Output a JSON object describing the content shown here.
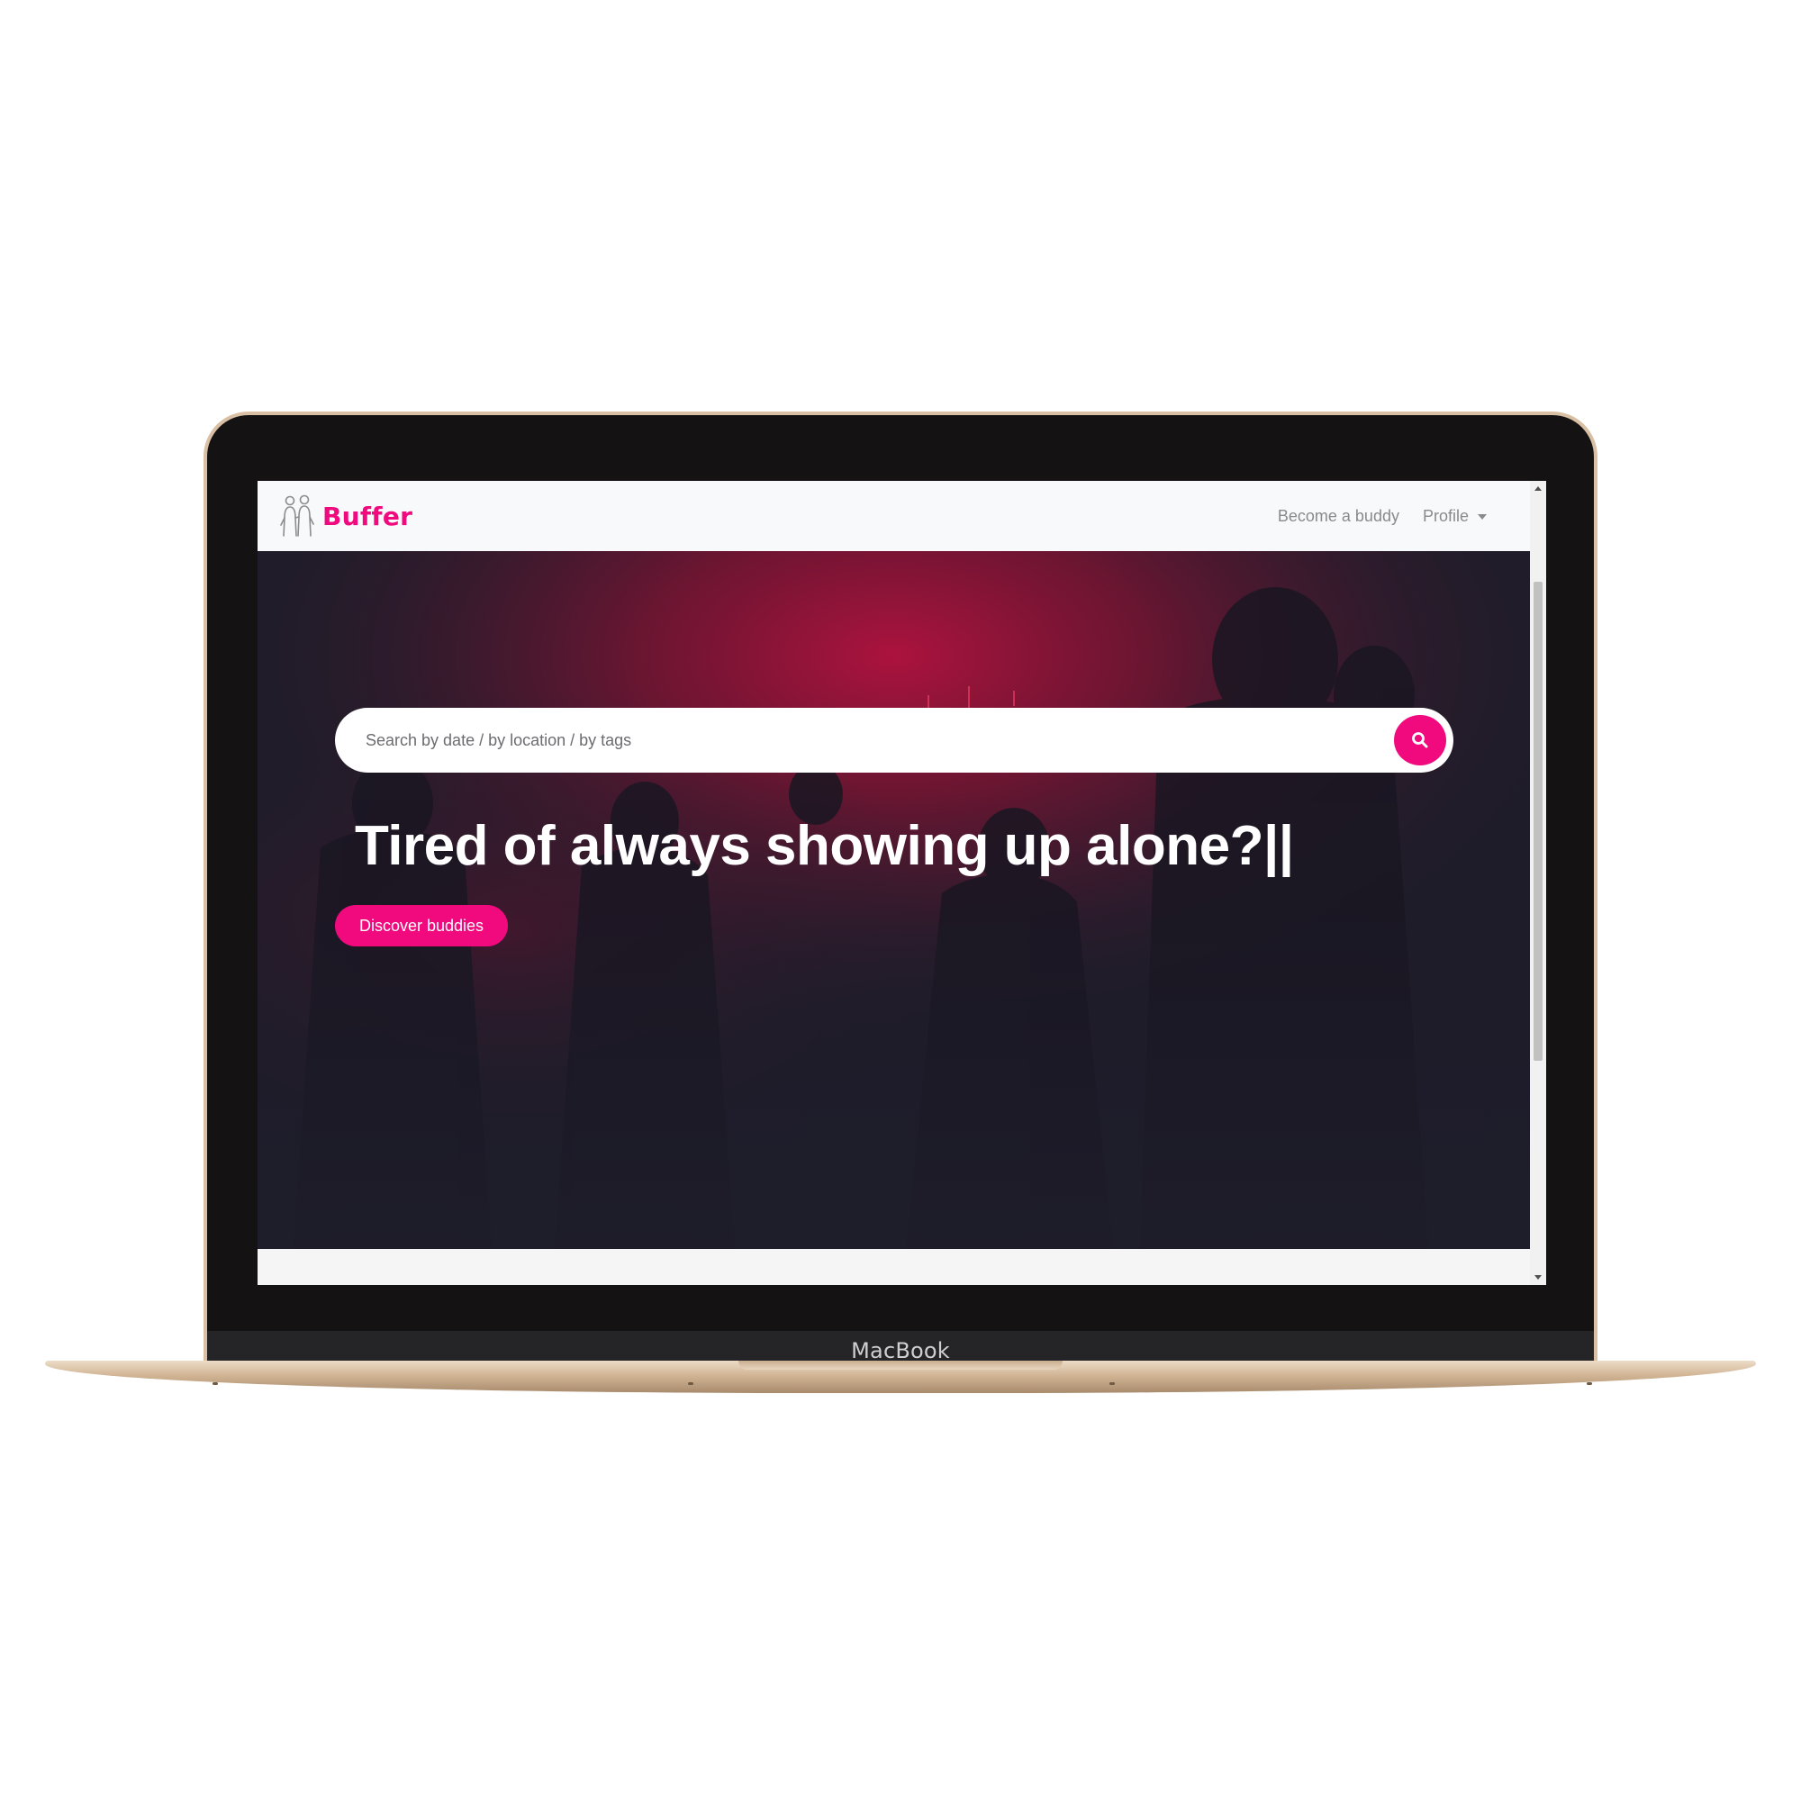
{
  "device": {
    "label": "MacBook"
  },
  "navbar": {
    "brand": "Buffer",
    "links": [
      {
        "label": "Become a buddy"
      },
      {
        "label": "Profile"
      }
    ]
  },
  "hero": {
    "search": {
      "placeholder": "Search by date / by location / by tags"
    },
    "title": "Tired of always showing up alone?||",
    "cta_label": "Discover buddies"
  },
  "colors": {
    "accent": "#f00a7e",
    "hero_background": "#1e1d2a",
    "navbar_background": "#f8f9fa",
    "device_frame": "#d9bfa3"
  },
  "icons": {
    "logo": "buddies-logo-icon",
    "search": "search-icon",
    "dropdown": "caret-down-icon"
  }
}
